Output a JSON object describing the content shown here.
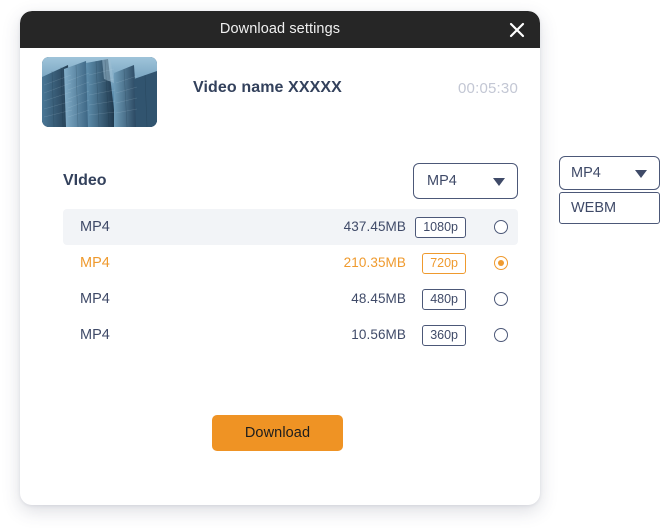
{
  "dialog": {
    "title": "Download settings",
    "close_icon": "close-icon"
  },
  "video": {
    "name": "Video name XXXXX",
    "duration": "00:05:30",
    "thumbnail_alt": "skyscraper-thumbnail"
  },
  "section": {
    "label": "VIdeo",
    "format_select": {
      "value": "MP4",
      "caret_icon": "chevron-down-icon"
    }
  },
  "quality_rows": [
    {
      "format": "MP4",
      "size": "437.45MB",
      "quality": "1080p",
      "selected": false,
      "highlight": true
    },
    {
      "format": "MP4",
      "size": "210.35MB",
      "quality": "720p",
      "selected": true,
      "highlight": false
    },
    {
      "format": "MP4",
      "size": "48.45MB",
      "quality": "480p",
      "selected": false,
      "highlight": false
    },
    {
      "format": "MP4",
      "size": "10.56MB",
      "quality": "360p",
      "selected": false,
      "highlight": false
    }
  ],
  "actions": {
    "download_label": "Download"
  },
  "side_dropdown": {
    "value": "MP4",
    "caret_icon": "chevron-down-icon",
    "options": [
      "WEBM"
    ]
  },
  "colors": {
    "accent_orange": "#ef9324",
    "selected_orange": "#ef9a2e",
    "titlebar": "#262626",
    "text_navy": "#33415c",
    "row_highlight": "#f2f4f7",
    "duration_gray": "#c3c7d4"
  }
}
